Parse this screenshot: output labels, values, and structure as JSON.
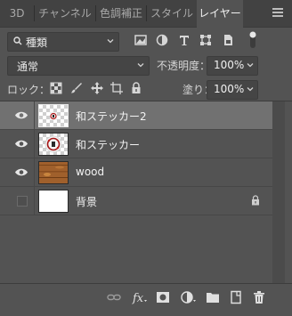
{
  "tabs": [
    {
      "label": "3D",
      "active": false
    },
    {
      "label": "チャンネル",
      "active": false
    },
    {
      "label": "色調補正",
      "active": false
    },
    {
      "label": "スタイル",
      "active": false
    },
    {
      "label": "レイヤー",
      "active": true
    }
  ],
  "filter": {
    "kind_label": "種類"
  },
  "blend": {
    "mode": "通常",
    "opacity_label": "不透明度：",
    "opacity_value": "100%",
    "lock_label": "ロック：",
    "fill_label": "塗り：",
    "fill_value": "100%"
  },
  "layers": [
    {
      "name": "和ステッカー2",
      "visible": true,
      "selected": true,
      "thumb": "sticker-small",
      "locked": false
    },
    {
      "name": "和ステッカー",
      "visible": true,
      "selected": false,
      "thumb": "sticker",
      "locked": false
    },
    {
      "name": "wood",
      "visible": true,
      "selected": false,
      "thumb": "wood",
      "locked": false
    },
    {
      "name": "背景",
      "visible": false,
      "selected": false,
      "thumb": "white",
      "locked": true
    }
  ],
  "colors": {
    "panel_bg": "#535353",
    "tab_bg": "#424242",
    "selected_row": "#717171",
    "text": "#f2f2f2"
  }
}
